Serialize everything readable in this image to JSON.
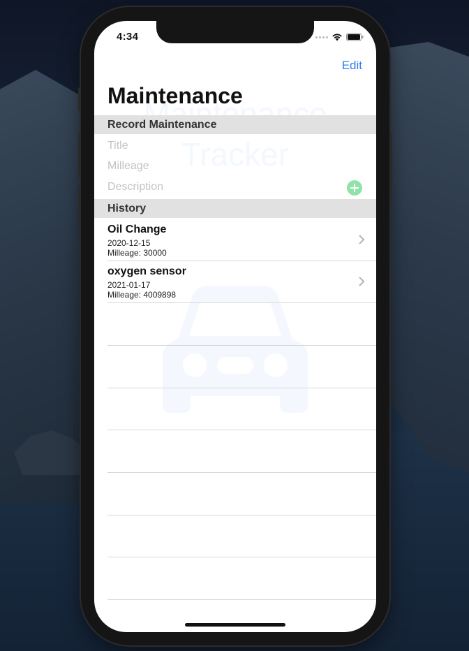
{
  "status_bar": {
    "time": "4:34"
  },
  "nav": {
    "edit_label": "Edit",
    "title": "Maintenance"
  },
  "watermark": {
    "line1": "Maintenance",
    "line2": "Tracker"
  },
  "record_section": {
    "header": "Record Maintenance",
    "title_placeholder": "Title",
    "mileage_placeholder": "Milleage",
    "description_placeholder": "Description"
  },
  "history_section": {
    "header": "History",
    "items": [
      {
        "title": "Oil Change",
        "date": "2020-12-15",
        "mileage": "Milleage: 30000"
      },
      {
        "title": "oxygen sensor",
        "date": "2021-01-17",
        "mileage": "Milleage: 4009898"
      }
    ]
  },
  "colors": {
    "accent": "#2f7ff0",
    "add_button": "#90e3a8",
    "section_header_bg": "#e1e1e1"
  }
}
